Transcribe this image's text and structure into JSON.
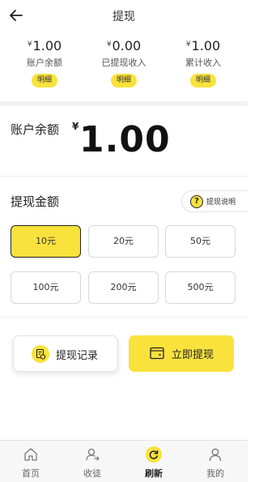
{
  "header": {
    "title": "提现",
    "back_icon": "back-arrow-icon"
  },
  "stats": [
    {
      "currency": "¥",
      "amount": "1.00",
      "label": "账户余额",
      "detail": "明细"
    },
    {
      "currency": "¥",
      "amount": "0.00",
      "label": "已提现收入",
      "detail": "明细"
    },
    {
      "currency": "¥",
      "amount": "1.00",
      "label": "累计收入",
      "detail": "明细"
    }
  ],
  "balance": {
    "label": "账户余额",
    "currency": "¥",
    "amount": "1.00"
  },
  "withdraw": {
    "title": "提现金额",
    "help_label": "提现说明",
    "help_glyph": "?",
    "options": [
      "10元",
      "20元",
      "50元",
      "100元",
      "200元",
      "500元"
    ],
    "selected": "10元"
  },
  "actions": {
    "records_label": "提现记录",
    "withdraw_label": "立即提现"
  },
  "tabbar": [
    {
      "label": "首页",
      "icon": "home-icon"
    },
    {
      "label": "收徒",
      "icon": "add-apprentice-icon"
    },
    {
      "label": "刷新",
      "icon": "refresh-icon",
      "active": true
    },
    {
      "label": "我的",
      "icon": "profile-icon"
    }
  ],
  "colors": {
    "accent": "#f9e23c",
    "text": "#222222",
    "muted": "#666666"
  }
}
